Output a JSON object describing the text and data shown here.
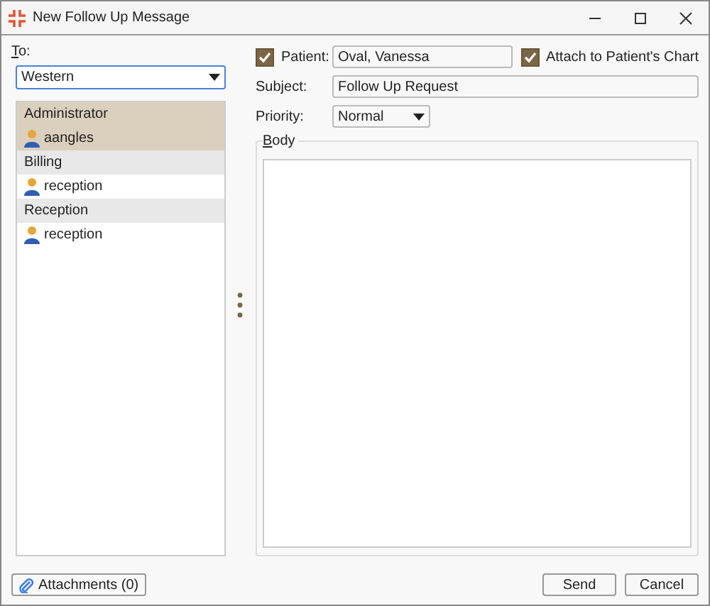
{
  "window": {
    "title": "New Follow Up Message"
  },
  "to": {
    "label": "To:",
    "location": "Western"
  },
  "recipients": [
    {
      "group": "Administrator",
      "selected": true,
      "members": [
        "aangles"
      ]
    },
    {
      "group": "Billing",
      "selected": false,
      "members": [
        "reception"
      ]
    },
    {
      "group": "Reception",
      "selected": false,
      "members": [
        "reception"
      ]
    }
  ],
  "patient": {
    "label": "Patient:",
    "checked": true,
    "value": "Oval, Vanessa"
  },
  "attach_to_chart": {
    "label": "Attach to Patient's Chart",
    "checked": true
  },
  "subject": {
    "label": "Subject:",
    "value": "Follow Up Request"
  },
  "priority": {
    "label": "Priority:",
    "value": "Normal"
  },
  "body": {
    "label": "Body"
  },
  "buttons": {
    "attachments": "Attachments (0)",
    "send": "Send",
    "cancel": "Cancel"
  }
}
